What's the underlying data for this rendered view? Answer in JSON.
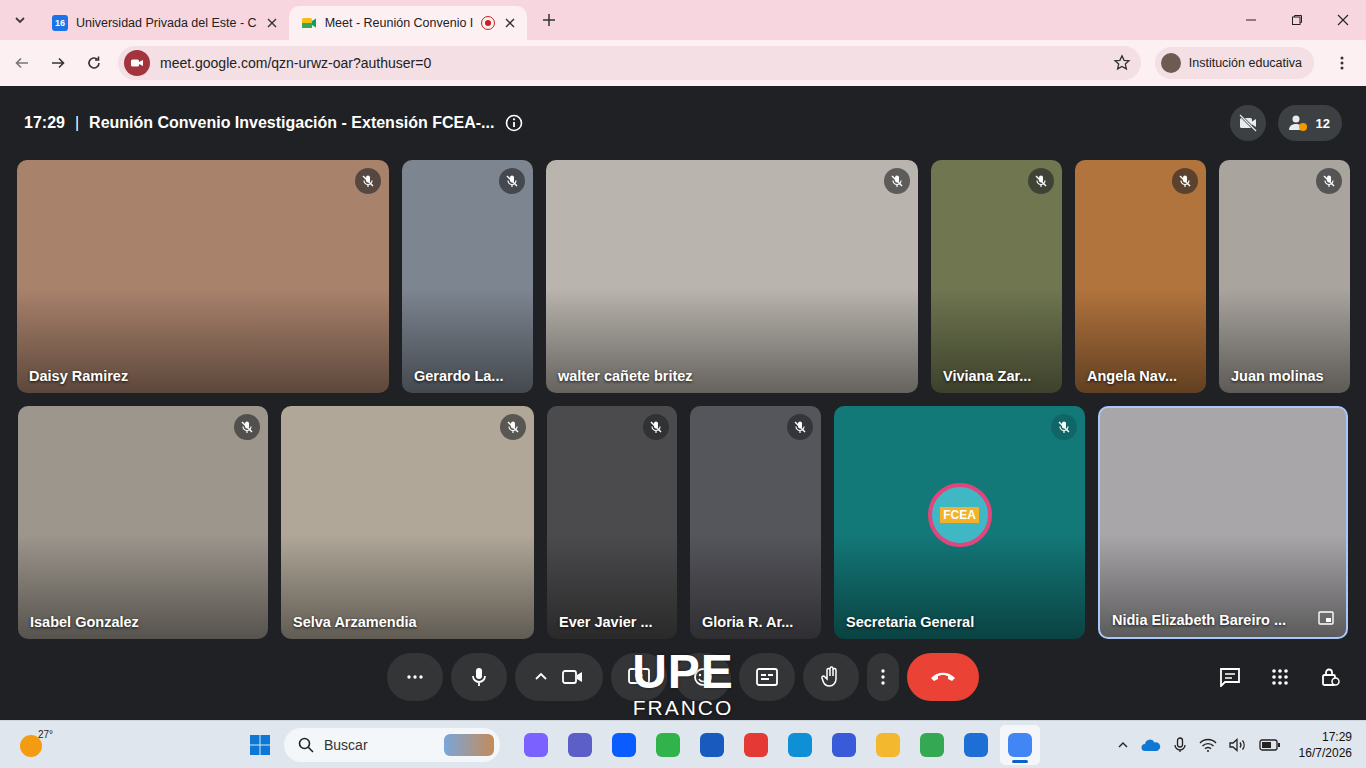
{
  "browser": {
    "tabs": [
      {
        "kind": "badge",
        "favicon_text": "16",
        "label": "Universidad Privada del Este - C",
        "selected": false,
        "recording": false
      },
      {
        "kind": "meet",
        "label": "Meet - Reunión Convenio I",
        "selected": true,
        "recording": true
      }
    ],
    "url": "meet.google.com/qzn-urwz-oar?authuser=0",
    "profile": "Institución educativa"
  },
  "meeting": {
    "time": "17:29",
    "separator": "|",
    "title": "Reunión Convenio Investigación - Extensión FCEA-...",
    "participant_count": "12"
  },
  "participants": [
    {
      "name": "Daisy Ramirez",
      "kind": "video",
      "muted": true,
      "highlighted": false,
      "color": "#a9826c"
    },
    {
      "name": "Gerardo La...",
      "kind": "video",
      "muted": true,
      "highlighted": false,
      "color": "#7d8590"
    },
    {
      "name": "walter cañete britez",
      "kind": "video",
      "muted": true,
      "highlighted": false,
      "color": "#b9b4ad"
    },
    {
      "name": "Viviana Zar...",
      "kind": "video",
      "muted": true,
      "highlighted": false,
      "color": "#6f7650"
    },
    {
      "name": "Angela Nav...",
      "kind": "video",
      "muted": true,
      "highlighted": false,
      "color": "#b2743d"
    },
    {
      "name": "Juan molinas",
      "kind": "video",
      "muted": true,
      "highlighted": false,
      "color": "#a9a49e"
    },
    {
      "name": "Isabel Gonzalez",
      "kind": "video",
      "muted": true,
      "highlighted": false,
      "color": "#9d968d"
    },
    {
      "name": "Selva Arzamendia",
      "kind": "video",
      "muted": true,
      "highlighted": false,
      "color": "#b0a798"
    },
    {
      "name": "Ever Javier ...",
      "kind": "video",
      "muted": true,
      "highlighted": false,
      "color": "#4b4b4d"
    },
    {
      "name": "Gloria R. Ar...",
      "kind": "video",
      "muted": true,
      "highlighted": false,
      "color": "#55555c"
    },
    {
      "name": "Secretaria General",
      "kind": "avatar",
      "logo_text": "FCEA",
      "muted": true,
      "highlighted": false,
      "color": "#137878"
    },
    {
      "name": "Nidia Elizabeth Bareiro ...",
      "kind": "video",
      "muted": false,
      "highlighted": true,
      "color": "#a8a6a8"
    }
  ],
  "watermark": {
    "line1": "UPE",
    "line2": "FRANCO"
  },
  "taskbar": {
    "temperature": "27°",
    "search_placeholder": "Buscar",
    "apps": [
      {
        "color": "#7b61ff",
        "selected": false
      },
      {
        "color": "#5b5fc7",
        "selected": false
      },
      {
        "color": "#0b5cff",
        "selected": false
      },
      {
        "color": "#2fb34a",
        "selected": false
      },
      {
        "color": "#185abd",
        "selected": false
      },
      {
        "color": "#e53935",
        "selected": false
      },
      {
        "color": "#0f8fd6",
        "selected": false
      },
      {
        "color": "#3a5bd9",
        "selected": false
      },
      {
        "color": "#f3b82e",
        "selected": false
      },
      {
        "color": "#34a853",
        "selected": false
      },
      {
        "color": "#1d6fd6",
        "selected": false
      },
      {
        "color": "#4285f4",
        "selected": true
      }
    ],
    "time": "17:29",
    "date": "16/7/2026"
  }
}
